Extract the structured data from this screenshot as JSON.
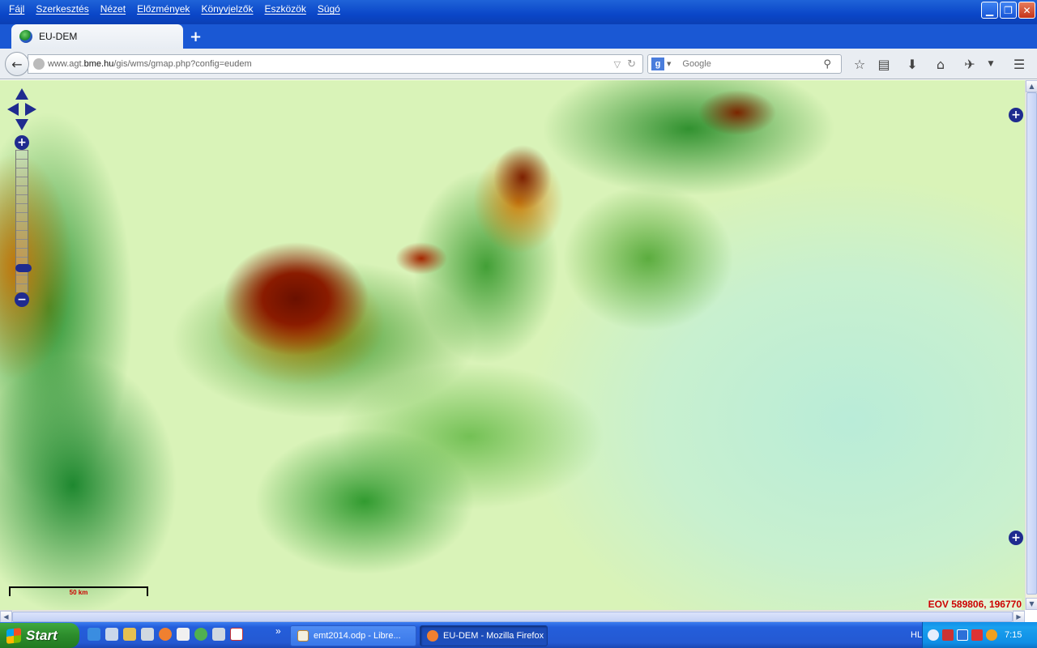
{
  "menu": [
    "Fájl",
    "Szerkesztés",
    "Nézet",
    "Előzmények",
    "Könyvjelzők",
    "Eszközök",
    "Súgó"
  ],
  "window_controls": {
    "minimize_icon": "minimize-icon",
    "maximize_icon": "restore-icon",
    "close_icon": "close-icon"
  },
  "tab": {
    "title": "EU-DEM",
    "icon": "globe-icon"
  },
  "newtab": "+",
  "nav": {
    "url": "www.agt.bme.hu/gis/wms/gmap.php?config=eudem",
    "url_prefix": "www.agt.",
    "url_domain": "bme.hu",
    "url_path": "/gis/wms/gmap.php?config=eudem",
    "search_placeholder": "Google"
  },
  "map": {
    "zoom_level_fraction": 0.85,
    "scale_label": "50 km",
    "coordinates": "EOV 589806, 196770"
  },
  "taskbar": {
    "start_label": "Start",
    "tasks": [
      {
        "label": "emt2014.odp - Libre...",
        "active": false
      },
      {
        "label": "EU-DEM - Mozilla Firefox",
        "active": true
      }
    ],
    "language": "HL",
    "clock": "7:15",
    "more": "»"
  },
  "colors": {
    "titlebar": "#0a46c8",
    "map_controls": "#1f2b8f",
    "coordinates": "#cc0000"
  }
}
